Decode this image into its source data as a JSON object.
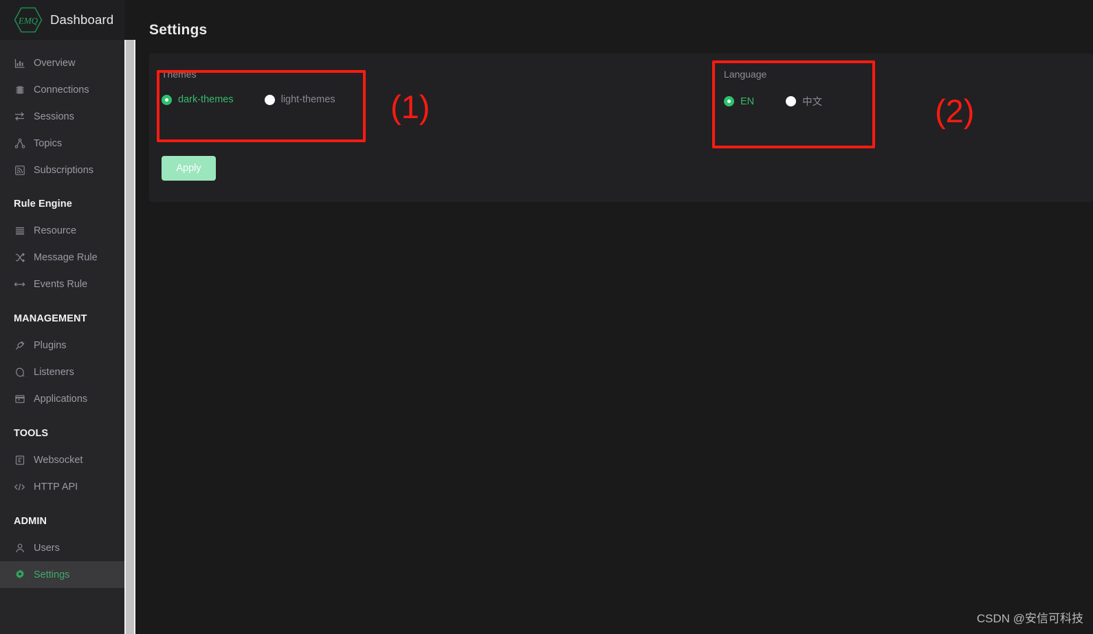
{
  "brand": {
    "logo_text": "EMQ",
    "logo_name": "emq-hexagon-logo",
    "title": "Dashboard"
  },
  "sidebar": {
    "items": [
      {
        "label": "Overview",
        "icon": "bar-chart-icon",
        "type": "item",
        "active": false
      },
      {
        "label": "Connections",
        "icon": "chip-icon",
        "type": "item",
        "active": false
      },
      {
        "label": "Sessions",
        "icon": "exchange-icon",
        "type": "item",
        "active": false
      },
      {
        "label": "Topics",
        "icon": "tree-node-icon",
        "type": "item",
        "active": false
      },
      {
        "label": "Subscriptions",
        "icon": "rss-icon",
        "type": "item",
        "active": false
      },
      {
        "label": "Rule Engine",
        "icon": "",
        "type": "group",
        "active": false
      },
      {
        "label": "Resource",
        "icon": "database-icon",
        "type": "item",
        "active": false
      },
      {
        "label": "Message Rule",
        "icon": "shuffle-icon",
        "type": "item",
        "active": false
      },
      {
        "label": "Events Rule",
        "icon": "arrows-icon",
        "type": "item",
        "active": false
      },
      {
        "label": "MANAGEMENT",
        "icon": "",
        "type": "group",
        "active": false
      },
      {
        "label": "Plugins",
        "icon": "plug-icon",
        "type": "item",
        "active": false
      },
      {
        "label": "Listeners",
        "icon": "ear-icon",
        "type": "item",
        "active": false
      },
      {
        "label": "Applications",
        "icon": "window-icon",
        "type": "item",
        "active": false
      },
      {
        "label": "TOOLS",
        "icon": "",
        "type": "group",
        "active": false
      },
      {
        "label": "Websocket",
        "icon": "terminal-icon",
        "type": "item",
        "active": false
      },
      {
        "label": "HTTP API",
        "icon": "code-icon",
        "type": "item",
        "active": false
      },
      {
        "label": "ADMIN",
        "icon": "",
        "type": "group",
        "active": false
      },
      {
        "label": "Users",
        "icon": "user-icon",
        "type": "item",
        "active": false
      },
      {
        "label": "Settings",
        "icon": "gear-icon",
        "type": "item",
        "active": true
      }
    ]
  },
  "page": {
    "title": "Settings"
  },
  "settings": {
    "themes": {
      "label": "Themes",
      "options": [
        {
          "label": "dark-themes",
          "selected": true
        },
        {
          "label": "light-themes",
          "selected": false
        }
      ]
    },
    "language": {
      "label": "Language",
      "options": [
        {
          "label": "EN",
          "selected": true
        },
        {
          "label": "中文",
          "selected": false
        }
      ]
    },
    "apply_label": "Apply"
  },
  "annotations": [
    {
      "id": "callout-1",
      "text": "(1)"
    },
    {
      "id": "callout-2",
      "text": "(2)"
    }
  ],
  "watermark": {
    "text": "CSDN @安信可科技"
  },
  "colors": {
    "accent_green": "#2fc26e",
    "selected_label": "#37b96b",
    "apply_button": "#9ce6bd",
    "annotation_red": "#fb1b10",
    "sidebar_bg": "#262628",
    "card_bg": "#212123",
    "page_bg": "#1a1a1b"
  }
}
